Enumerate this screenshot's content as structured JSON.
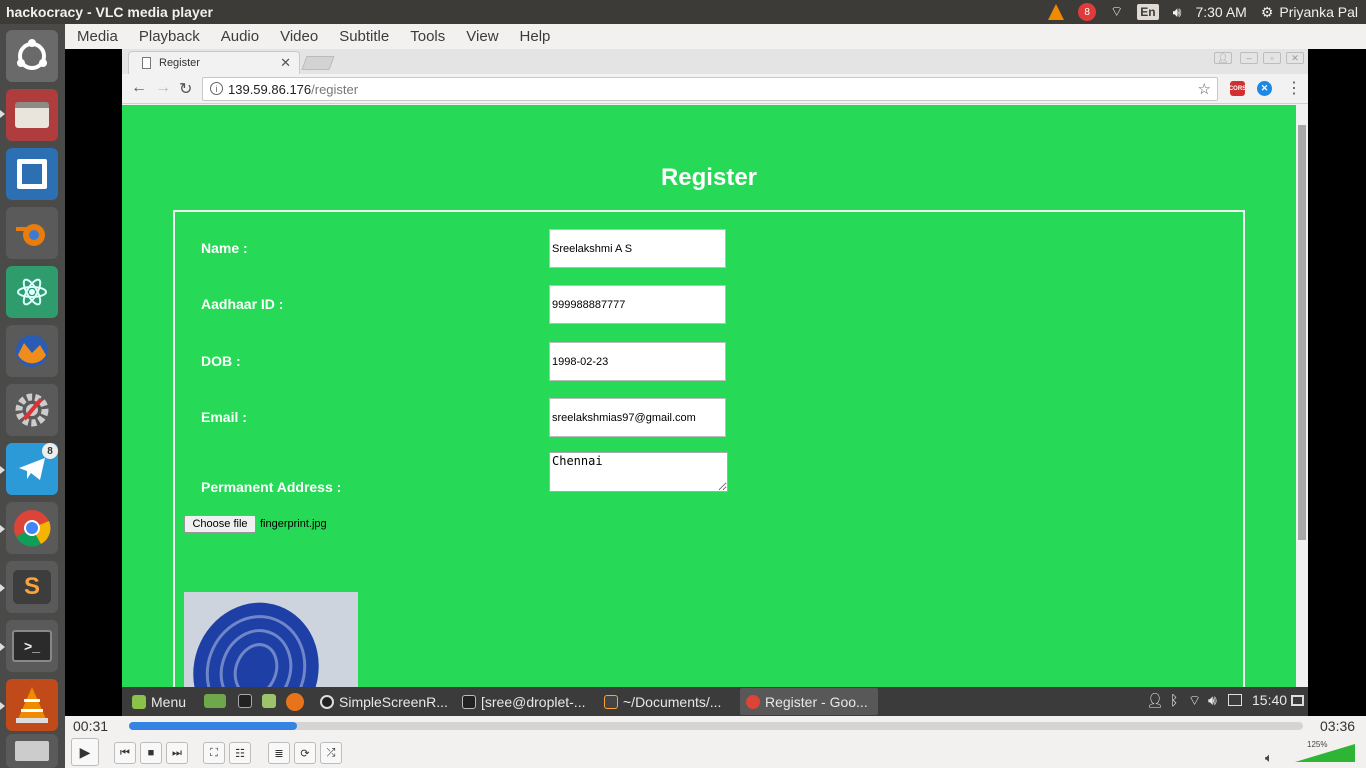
{
  "top_panel": {
    "window_title": "hackocracy - VLC media player",
    "notification_count": "8",
    "keyboard_layout": "En",
    "clock": "7:30 AM",
    "user": "Priyanka Pal"
  },
  "launcher": {
    "telegram_badge": "8",
    "sublime_letter": "S"
  },
  "vlc_menu": [
    "Media",
    "Playback",
    "Audio",
    "Video",
    "Subtitle",
    "Tools",
    "View",
    "Help"
  ],
  "browser": {
    "tab_title": "Register",
    "url_host": "139.59.86.176",
    "url_path": "/register",
    "ext_label": "CORS"
  },
  "page": {
    "title": "Register",
    "labels": {
      "name": "Name :",
      "aadhaar": "Aadhaar ID :",
      "dob": "DOB :",
      "email": "Email :",
      "address": "Permanent Address :"
    },
    "values": {
      "name": "Sreelakshmi A S",
      "aadhaar": "999988887777",
      "dob": "1998-02-23",
      "email": "sreelakshmias97@gmail.com",
      "address": "Chennai"
    },
    "choose_file": "Choose file",
    "file_name": "fingerprint.jpg"
  },
  "taskbar": {
    "menu": "Menu",
    "windows": [
      "SimpleScreenR...",
      "[sree@droplet-...",
      "~/Documents/...",
      "Register - Goo..."
    ],
    "clock": "15:40"
  },
  "vlc": {
    "elapsed": "00:31",
    "total": "03:36",
    "progress": 0.143,
    "volume_label": "125%"
  },
  "colors": {
    "page_bg": "#26d956",
    "seek_fill": "#3584e4",
    "volume": "#2fb536"
  }
}
